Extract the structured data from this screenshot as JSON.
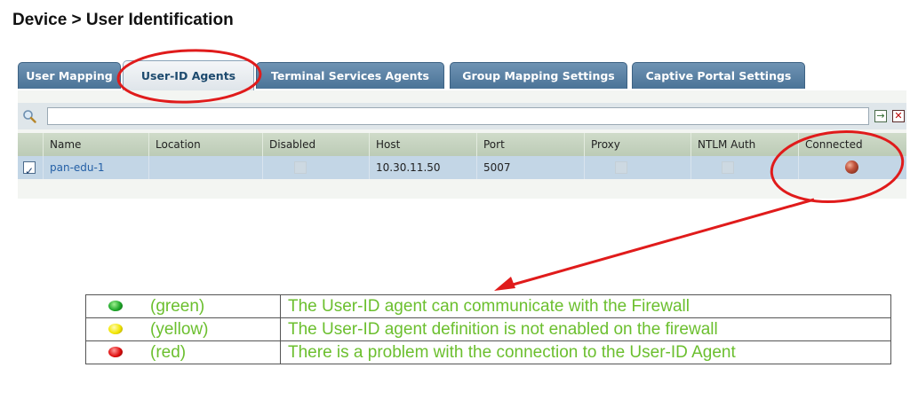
{
  "page": {
    "title": "Device > User Identification"
  },
  "tabs": [
    {
      "label": "User Mapping",
      "active": false
    },
    {
      "label": "User-ID Agents",
      "active": true
    },
    {
      "label": "Terminal Services Agents",
      "active": false
    },
    {
      "label": "Group Mapping Settings",
      "active": false
    },
    {
      "label": "Captive Portal Settings",
      "active": false
    }
  ],
  "search": {
    "value": "",
    "placeholder": "",
    "go_icon": "arrow-right-icon",
    "clear_icon": "close-icon"
  },
  "table": {
    "columns": [
      "Name",
      "Location",
      "Disabled",
      "Host",
      "Port",
      "Proxy",
      "NTLM Auth",
      "Connected"
    ],
    "rows": [
      {
        "selected": true,
        "name": "pan-edu-1",
        "location": "",
        "disabled": false,
        "host": "10.30.11.50",
        "port": "5007",
        "proxy": false,
        "ntlm_auth": false,
        "connected": "red"
      }
    ]
  },
  "legend": [
    {
      "color": "#1fa82a",
      "label": "(green)",
      "text": "The User-ID agent can communicate with the Firewall"
    },
    {
      "color": "#f2e600",
      "label": "(yellow)",
      "text": "The User-ID agent definition is not enabled on the firewall"
    },
    {
      "color": "#e01010",
      "label": "(red)",
      "text": "There is a problem with the connection to the User-ID Agent"
    }
  ],
  "colors": {
    "annotation": "#e01b1b",
    "legend_text": "#6bbf2e",
    "header": "#c6d3bf",
    "row": "#c3d6e6"
  }
}
